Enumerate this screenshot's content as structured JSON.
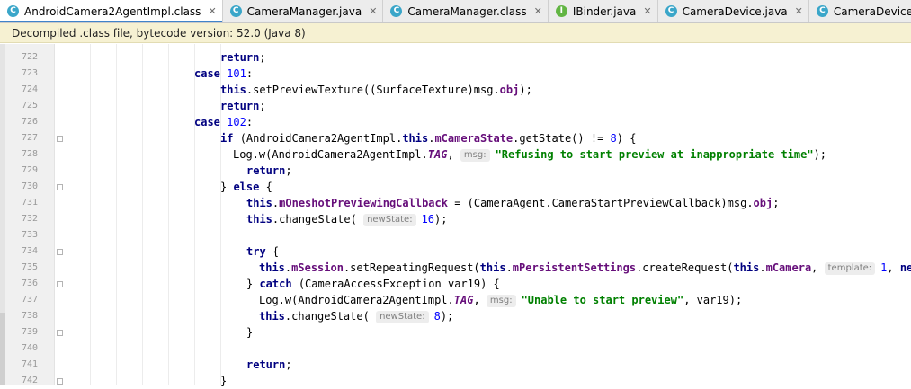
{
  "tabs": [
    {
      "label": "AndroidCamera2AgentImpl.class",
      "icon": "class-file-icon",
      "type": "class",
      "active": true
    },
    {
      "label": "CameraManager.java",
      "icon": "java-class-icon",
      "type": "java",
      "active": false
    },
    {
      "label": "CameraManager.class",
      "icon": "class-file-icon",
      "type": "class",
      "active": false
    },
    {
      "label": "IBinder.java",
      "icon": "interface-icon",
      "type": "iface",
      "active": false
    },
    {
      "label": "CameraDevice.java",
      "icon": "java-class-icon",
      "type": "java",
      "active": false
    },
    {
      "label": "CameraDeviceImpl.class",
      "icon": "class-file-icon",
      "type": "class",
      "active": false
    }
  ],
  "banner": {
    "text": "Decompiled .class file, bytecode version: 52.0 (Java 8)"
  },
  "code": [
    {
      "num": "722",
      "segs": [
        [
          "k",
          "return"
        ],
        [
          "p",
          ";"
        ]
      ]
    },
    {
      "num": "723",
      "segs": [
        [
          "k",
          "case "
        ],
        [
          "n",
          "101"
        ],
        [
          "p",
          ":"
        ]
      ]
    },
    {
      "num": "724",
      "segs": [
        [
          "k",
          "this"
        ],
        [
          "p",
          ".setPreviewTexture((SurfaceTexture)msg."
        ],
        [
          "f",
          "obj"
        ],
        [
          "p",
          ");"
        ]
      ]
    },
    {
      "num": "725",
      "segs": [
        [
          "k",
          "return"
        ],
        [
          "p",
          ";"
        ]
      ]
    },
    {
      "num": "726",
      "segs": [
        [
          "k",
          "case "
        ],
        [
          "n",
          "102"
        ],
        [
          "p",
          ":"
        ]
      ]
    },
    {
      "num": "727",
      "segs": [
        [
          "k",
          "if "
        ],
        [
          "p",
          "(AndroidCamera2AgentImpl."
        ],
        [
          "k",
          "this"
        ],
        [
          "p",
          "."
        ],
        [
          "f",
          "mCameraState"
        ],
        [
          "p",
          ".getState() != "
        ],
        [
          "n",
          "8"
        ],
        [
          "p",
          ") {"
        ]
      ]
    },
    {
      "num": "728",
      "segs": [
        [
          "p",
          "Log.w(AndroidCamera2AgentImpl."
        ],
        [
          "fi",
          "TAG"
        ],
        [
          "p",
          ", "
        ],
        [
          "h",
          "msg:"
        ],
        [
          "s",
          "\"Refusing to start preview at inappropriate time\""
        ],
        [
          "p",
          ");"
        ]
      ]
    },
    {
      "num": "729",
      "segs": [
        [
          "k",
          "return"
        ],
        [
          "p",
          ";"
        ]
      ]
    },
    {
      "num": "730",
      "segs": [
        [
          "p",
          "} "
        ],
        [
          "k",
          "else "
        ],
        [
          "p",
          "{"
        ]
      ]
    },
    {
      "num": "731",
      "segs": [
        [
          "k",
          "this"
        ],
        [
          "p",
          "."
        ],
        [
          "f",
          "mOneshotPreviewingCallback"
        ],
        [
          "p",
          " = (CameraAgent.CameraStartPreviewCallback)msg."
        ],
        [
          "f",
          "obj"
        ],
        [
          "p",
          ";"
        ]
      ]
    },
    {
      "num": "732",
      "segs": [
        [
          "k",
          "this"
        ],
        [
          "p",
          ".changeState( "
        ],
        [
          "h",
          "newState:"
        ],
        [
          "n",
          "16"
        ],
        [
          "p",
          ");"
        ]
      ]
    },
    {
      "num": "733",
      "segs": []
    },
    {
      "num": "734",
      "segs": [
        [
          "k",
          "try "
        ],
        [
          "p",
          "{"
        ]
      ]
    },
    {
      "num": "735",
      "segs": [
        [
          "k",
          "this"
        ],
        [
          "p",
          "."
        ],
        [
          "f",
          "mSession"
        ],
        [
          "p",
          ".setRepeatingRequest("
        ],
        [
          "k",
          "this"
        ],
        [
          "p",
          "."
        ],
        [
          "f",
          "mPersistentSettings"
        ],
        [
          "p",
          ".createRequest("
        ],
        [
          "k",
          "this"
        ],
        [
          "p",
          "."
        ],
        [
          "f",
          "mCamera"
        ],
        [
          "p",
          ", "
        ],
        [
          "h",
          "template:"
        ],
        [
          "n",
          "1"
        ],
        [
          "p",
          ", "
        ],
        [
          "k",
          "new"
        ]
      ]
    },
    {
      "num": "736",
      "segs": [
        [
          "p",
          "} "
        ],
        [
          "k",
          "catch "
        ],
        [
          "p",
          "(CameraAccessException var19) {"
        ]
      ]
    },
    {
      "num": "737",
      "segs": [
        [
          "p",
          "Log.w(AndroidCamera2AgentImpl."
        ],
        [
          "fi",
          "TAG"
        ],
        [
          "p",
          ", "
        ],
        [
          "h",
          "msg:"
        ],
        [
          "s",
          "\"Unable to start preview\""
        ],
        [
          "p",
          ", var19);"
        ]
      ]
    },
    {
      "num": "738",
      "segs": [
        [
          "k",
          "this"
        ],
        [
          "p",
          ".changeState( "
        ],
        [
          "h",
          "newState:"
        ],
        [
          "n",
          "8"
        ],
        [
          "p",
          ");"
        ]
      ]
    },
    {
      "num": "739",
      "segs": [
        [
          "p",
          "}"
        ]
      ]
    },
    {
      "num": "740",
      "segs": []
    },
    {
      "num": "741",
      "segs": [
        [
          "k",
          "return"
        ],
        [
          "p",
          ";"
        ]
      ]
    },
    {
      "num": "742",
      "segs": [
        [
          "p",
          "}"
        ]
      ]
    }
  ]
}
